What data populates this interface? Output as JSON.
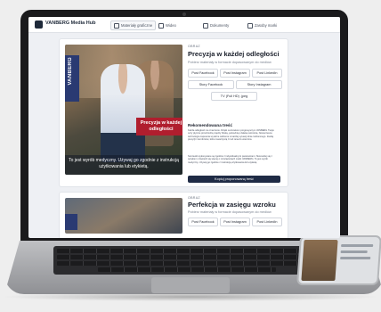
{
  "app": {
    "title": "VANBERG Media Hub",
    "tabs": [
      {
        "label": "Materiały graficzne"
      },
      {
        "label": "Wideo"
      },
      {
        "label": "Dokumenty"
      },
      {
        "label": "Zasoby marki"
      }
    ]
  },
  "hero_card": {
    "brand": "VANBERG",
    "badge": "Precyzja w każdej odległości",
    "caption": "To jest wyrób medyczny. Używaj go zgodnie z instrukcją użytkowania lub etykietą.",
    "kicker": "OBRAZ",
    "title": "Precyzja w każdej odległości",
    "subtitle": "Pobierz materiały w formacie dopasowanym do mediów",
    "buttons": [
      {
        "label": "Post Facebook"
      },
      {
        "label": "Post Instagram"
      },
      {
        "label": "Post LinkedIn"
      },
      {
        "label": "Story Facebook"
      },
      {
        "label": "Story Instagram"
      },
      {
        "label": "TV (Full HD) .jpeg"
      }
    ],
    "recommended_heading": "Rekomendowana treść",
    "paragraph_1": "Każda odległość ma znaczenie. Dzięki soczewkom progresywnym VANBERG Twoje oczy płynnie przechodzą między bliską, pośrednią i daleką ostrością. Nowoczesna technologia zapewnia wyraźne widzenie w każdej sytuacji dnia codziennego. Zaufaj precyzji i komfortowi, które towarzyszą Ci od rana do wieczora.",
    "paragraph_2": "Soczewki wykonywane są zgodnie z indywidualnymi parametrami. Skonsultuj się z optykiem i dowiedz się więcej o rozwiązaniach marki VANBERG. To jest wyrób medyczny. Używaj go zgodnie z instrukcją użytkowania lub etykietą.",
    "copy_button": "Kopiuj proponowaną treść"
  },
  "second_card": {
    "kicker": "OBRAZ",
    "title": "Perfekcja w zasięgu wzroku",
    "subtitle": "Pobierz materiały w formacie dopasowanym do mediów",
    "buttons": [
      {
        "label": "Post Facebook"
      },
      {
        "label": "Post Instagram"
      },
      {
        "label": "Post LinkedIn"
      }
    ]
  }
}
